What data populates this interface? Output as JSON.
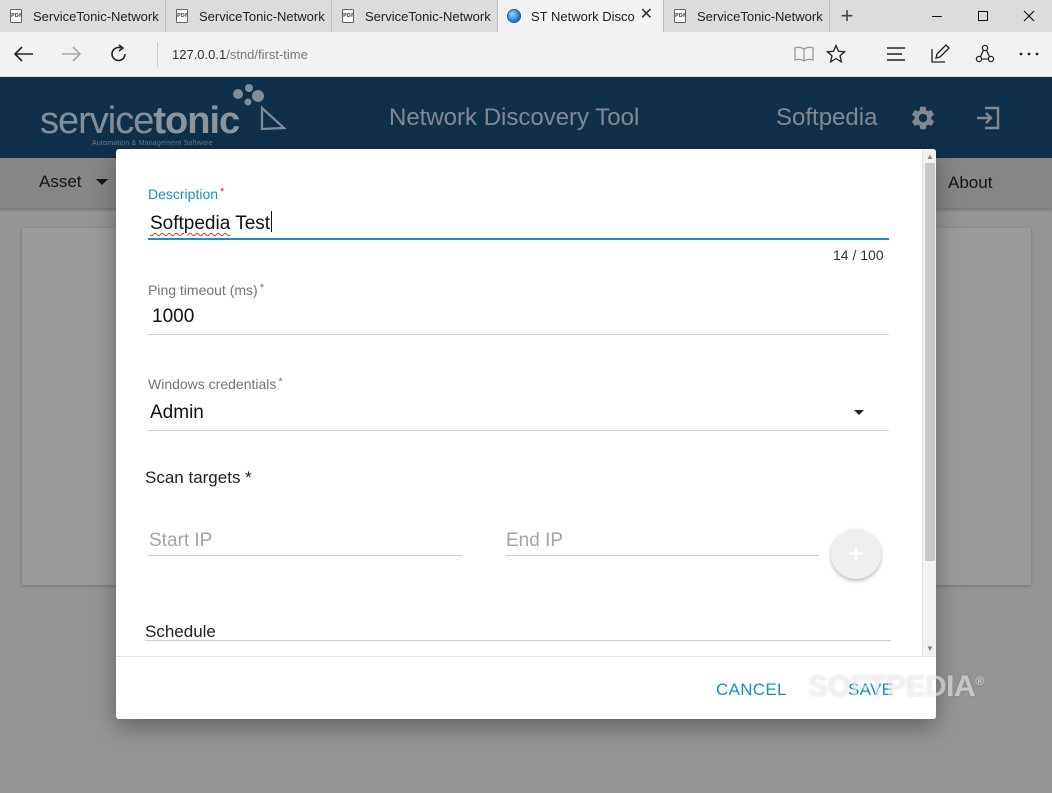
{
  "browser": {
    "tabs": [
      {
        "title": "ServiceTonic-Network",
        "icon": "pdf-icon",
        "active": false
      },
      {
        "title": "ServiceTonic-Network",
        "icon": "pdf-icon",
        "active": false
      },
      {
        "title": "ServiceTonic-Network",
        "icon": "pdf-icon",
        "active": false
      },
      {
        "title": "ST Network Disco",
        "icon": "globe-icon",
        "active": true
      },
      {
        "title": "ServiceTonic-Network",
        "icon": "pdf-icon",
        "active": false
      }
    ],
    "new_tab_label": "+",
    "url_host": "127.0.0.1",
    "url_path": "/stnd/first-time"
  },
  "app": {
    "logo_regular": "service",
    "logo_bold": "tonic",
    "logo_tagline": "Automation & Management Software",
    "title": "Network Discovery Tool",
    "user": "Softpedia",
    "menu_asset": "Asset",
    "menu_about": "About",
    "header_color": "#1a4e78"
  },
  "dialog": {
    "description": {
      "label": "Description",
      "required": "*",
      "value_word1": "Softpedia",
      "value_word2": " Test",
      "counter": "14 / 100"
    },
    "ping_timeout": {
      "label": "Ping timeout (ms)",
      "required": "*",
      "value": "1000"
    },
    "windows_credentials": {
      "label": "Windows credentials",
      "required": "*",
      "value": "Admin"
    },
    "scan_targets": {
      "title": "Scan targets *",
      "start_ip_placeholder": "Start IP",
      "end_ip_placeholder": "End IP",
      "add_label": "+"
    },
    "schedule": {
      "title": "Schedule"
    },
    "cancel_label": "CANCEL",
    "save_label": "SAVE",
    "accent_color": "#1b8fc4"
  },
  "watermark": {
    "text": "SOFTPEDIA",
    "mark": "®"
  }
}
